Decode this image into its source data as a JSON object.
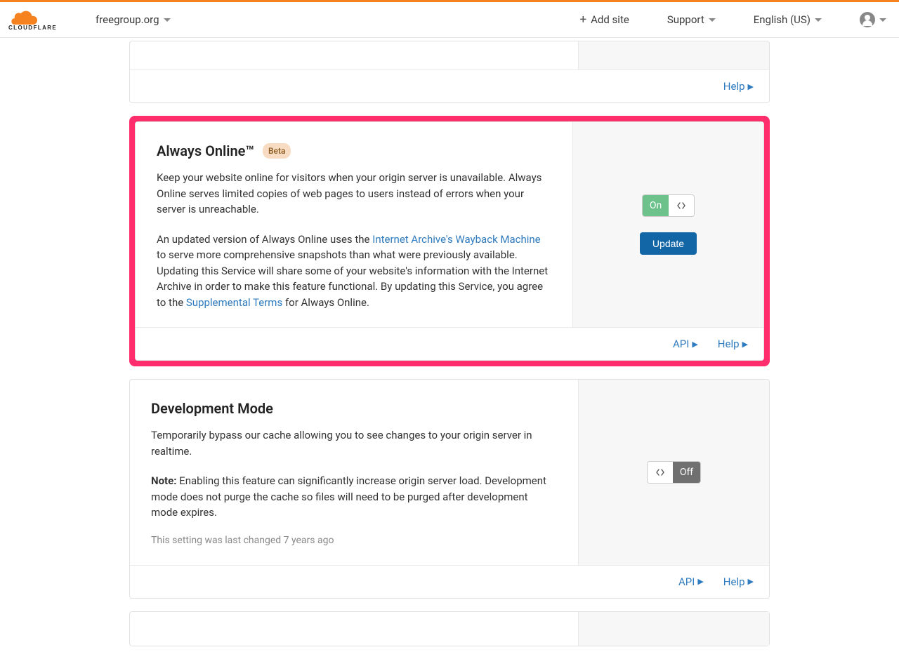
{
  "header": {
    "site": "freegroup.org",
    "add_site": "Add site",
    "support": "Support",
    "language": "English (US)"
  },
  "card_prev_footer": {
    "help": "Help"
  },
  "always_online": {
    "title": "Always Online™",
    "badge": "Beta",
    "desc1": "Keep your website online for visitors when your origin server is unavailable. Always Online serves limited copies of web pages to users instead of errors when your server is unreachable.",
    "desc2_a": "An updated version of Always Online uses the ",
    "link_wayback": "Internet Archive's Wayback Machine",
    "desc2_b": " to serve more comprehensive snapshots than what were previously available. Updating this Service will share some of your website's information with the Internet Archive in order to make this feature functional. By updating this Service, you agree to the ",
    "link_terms": "Supplemental Terms",
    "desc2_c": " for Always Online.",
    "toggle": "On",
    "update_btn": "Update",
    "footer_api": "API",
    "footer_help": "Help"
  },
  "dev_mode": {
    "title": "Development Mode",
    "desc1": "Temporarily bypass our cache allowing you to see changes to your origin server in realtime.",
    "note_label": "Note:",
    "note_text": " Enabling this feature can significantly increase origin server load. Development mode does not purge the cache so files will need to be purged after development mode expires.",
    "last_changed": "This setting was last changed 7 years ago",
    "toggle": "Off",
    "footer_api": "API",
    "footer_help": "Help"
  }
}
